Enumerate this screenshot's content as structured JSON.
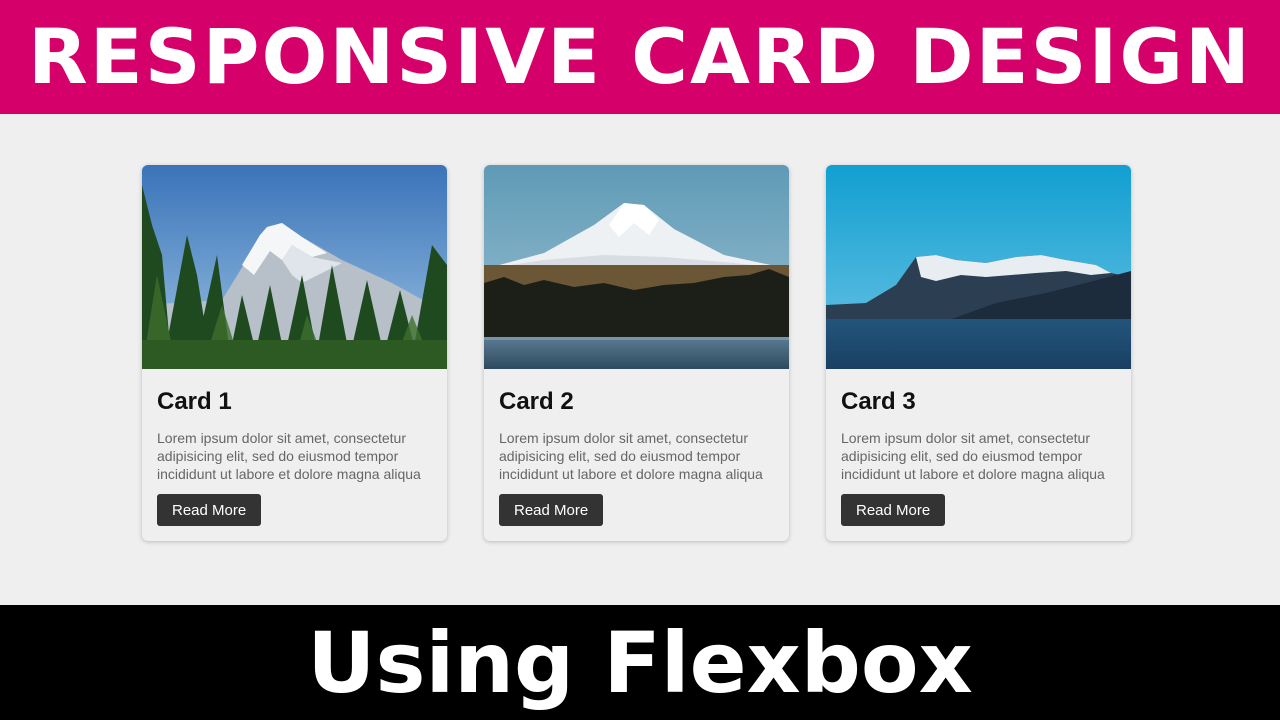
{
  "banner": {
    "title": "RESPONSIVE CARD DESIGN",
    "subtitle": "Using Flexbox",
    "title_bg": "#d6006b",
    "subtitle_bg": "#000000"
  },
  "cards": [
    {
      "title": "Card 1",
      "text": "Lorem ipsum dolor sit amet, consectetur adipisicing elit, sed do eiusmod tempor incididunt ut labore et dolore magna aliqua",
      "button": "Read More",
      "image": "mountain-forest-image"
    },
    {
      "title": "Card 2",
      "text": "Lorem ipsum dolor sit amet, consectetur adipisicing elit, sed do eiusmod tempor incididunt ut labore et dolore magna aliqua",
      "button": "Read More",
      "image": "mountain-lake-image"
    },
    {
      "title": "Card 3",
      "text": "Lorem ipsum dolor sit amet, consectetur adipisicing elit, sed do eiusmod tempor incididunt ut labore et dolore magna aliqua",
      "button": "Read More",
      "image": "mountain-sea-image"
    }
  ]
}
